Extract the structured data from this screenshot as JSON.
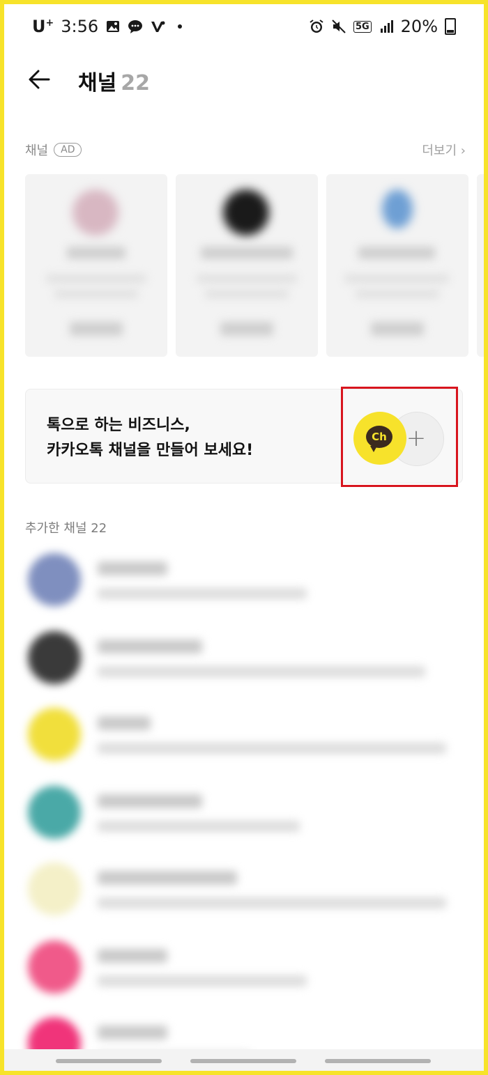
{
  "status_bar": {
    "carrier": "U",
    "carrier_sup": "+",
    "time": "3:56",
    "network": "5G",
    "battery": "20%",
    "icons_left": [
      "gallery-icon",
      "chat-icon",
      "v-app-icon",
      "dot-icon"
    ],
    "icons_right": [
      "alarm-icon",
      "mute-icon",
      "network-5g-icon",
      "signal-icon",
      "battery-icon"
    ]
  },
  "header": {
    "title": "채널",
    "count": "22"
  },
  "ad_section": {
    "title": "채널",
    "badge": "AD",
    "more_label": "더보기",
    "cards": [
      {
        "logo_color": "#d8b7c2"
      },
      {
        "logo_color": "#1a1a1a"
      },
      {
        "logo_color": "#6e9fd4"
      }
    ]
  },
  "promo": {
    "line1": "톡으로 하는 비즈니스,",
    "line2": "카카오톡 채널을 만들어 보세요!",
    "ch_label": "Ch",
    "plus_glyph": "+"
  },
  "added_section": {
    "title": "추가한 채널 22"
  },
  "channels": [
    {
      "avatar_color": "#7f8fbf"
    },
    {
      "avatar_color": "#3a3a3a"
    },
    {
      "avatar_color": "#f1df3c"
    },
    {
      "avatar_color": "#4aa9a7"
    },
    {
      "avatar_color": "#f4f0c8"
    },
    {
      "avatar_color": "#f05a8a"
    },
    {
      "avatar_color": "#f0347a"
    }
  ],
  "colors": {
    "frame_border": "#f7e32a",
    "highlight": "#d8151e",
    "kakao_yellow": "#f7e22b",
    "kakao_brown": "#3b2a1e"
  }
}
